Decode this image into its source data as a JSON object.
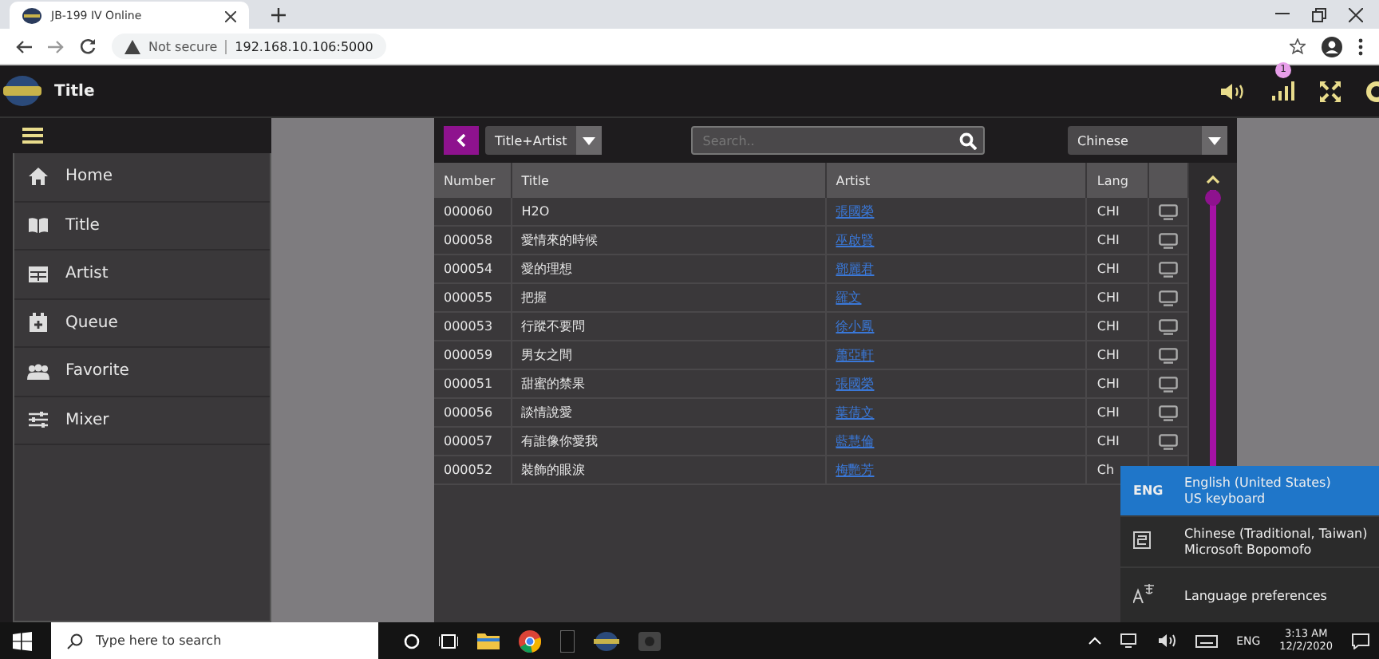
{
  "browser": {
    "tab_title": "JB-199 IV Online",
    "security_label": "Not secure",
    "url": "192.168.10.106:5000"
  },
  "app": {
    "title": "Title",
    "badge": "1"
  },
  "sidebar": {
    "items": [
      {
        "label": "Home"
      },
      {
        "label": "Title"
      },
      {
        "label": "Artist"
      },
      {
        "label": "Queue"
      },
      {
        "label": "Favorite"
      },
      {
        "label": "Mixer"
      }
    ]
  },
  "toolbar": {
    "search_mode": "Title+Artist",
    "search": {
      "placeholder": "Search.."
    },
    "language": "Chinese"
  },
  "table": {
    "columns": [
      "Number",
      "Title",
      "Artist",
      "Lang"
    ],
    "rows": [
      {
        "number": "000060",
        "title": "H2O",
        "artist": "張國榮",
        "lang": "CHI"
      },
      {
        "number": "000058",
        "title": "愛情來的時候",
        "artist": "巫啟賢",
        "lang": "CHI"
      },
      {
        "number": "000054",
        "title": "愛的理想",
        "artist": "鄧麗君",
        "lang": "CHI"
      },
      {
        "number": "000055",
        "title": "把握",
        "artist": "羅文",
        "lang": "CHI"
      },
      {
        "number": "000053",
        "title": "行蹤不要問",
        "artist": "徐小鳳",
        "lang": "CHI"
      },
      {
        "number": "000059",
        "title": "男女之間",
        "artist": "蕭亞軒",
        "lang": "CHI"
      },
      {
        "number": "000051",
        "title": "甜蜜的禁果",
        "artist": "張國榮",
        "lang": "CHI"
      },
      {
        "number": "000056",
        "title": "談情說愛",
        "artist": "葉蒨文",
        "lang": "CHI"
      },
      {
        "number": "000057",
        "title": "有誰像你愛我",
        "artist": "藍慧倫",
        "lang": "CHI"
      },
      {
        "number": "000052",
        "title": "裝飾的眼淚",
        "artist": "梅艷芳",
        "lang": "Ch"
      }
    ]
  },
  "language_popup": {
    "items": [
      {
        "kind": "code",
        "code": "ENG",
        "name": "English (United States)",
        "keyboard": "US keyboard",
        "selected": true
      },
      {
        "kind": "icon",
        "name": "Chinese (Traditional, Taiwan)",
        "keyboard": "Microsoft Bopomofo",
        "selected": false
      }
    ],
    "preferences": "Language preferences"
  },
  "taskbar": {
    "search": {
      "placeholder": "Type here to search"
    },
    "input_indicator": "ENG",
    "time": "3:13 AM",
    "date": "12/2/2020"
  }
}
